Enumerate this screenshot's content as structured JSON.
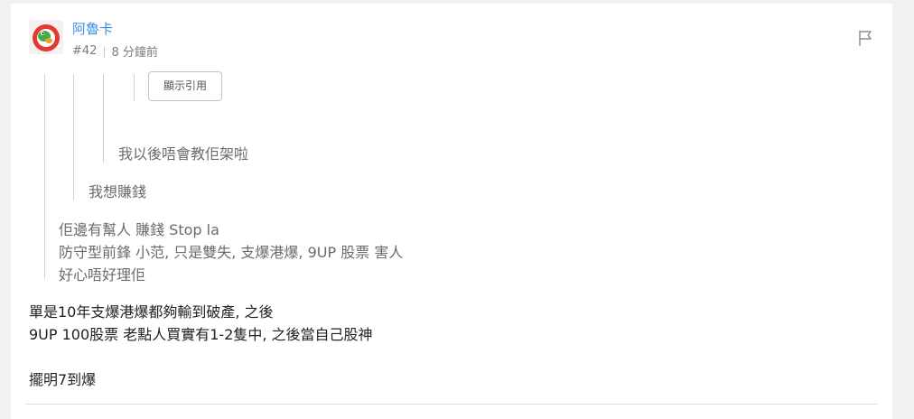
{
  "post": {
    "username": "阿魯卡",
    "floor": "#42",
    "time": "8 分鐘前",
    "quote_button": "顯示引用",
    "quote3": "我以後唔會教佢架啦",
    "quote2": "我想賺錢",
    "quote1": [
      "佢邊有幫人 賺錢 Stop la",
      "防守型前鋒 小范, 只是雙失, 支爆港爆, 9UP 股票 害人",
      "好心唔好理佢"
    ],
    "body": [
      "單是10年支爆港爆都夠輸到破產, 之後",
      "9UP 100股票 老點人買實有1-2隻中, 之後當自己股神",
      "",
      "擺明7到爆"
    ]
  },
  "colors": {
    "username": "#3b8de0",
    "quote_text": "#6b6b6b",
    "body_text": "#222222"
  },
  "icons": {
    "avatar": "yoshi-avatar",
    "report": "flag-icon"
  }
}
